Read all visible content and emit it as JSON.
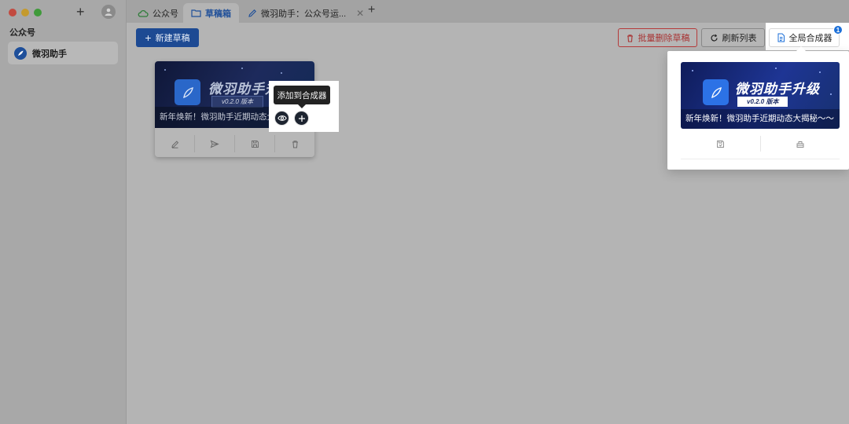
{
  "sidebar": {
    "section_title": "公众号",
    "account_name": "微羽助手"
  },
  "tabs": [
    {
      "label": "公众号",
      "icon": "cloud-icon"
    },
    {
      "label": "草稿箱",
      "icon": "folder-icon"
    },
    {
      "label": "微羽助手：公众号运...",
      "icon": "edit-icon"
    }
  ],
  "toolbar": {
    "new_draft": "新建草稿",
    "batch_delete": "批量删除草稿",
    "refresh": "刷新列表",
    "composer": "全局合成器",
    "composer_badge": "1"
  },
  "draft": {
    "headline": "微羽助手升级",
    "version": "v0.2.0 版本",
    "caption": "新年焕新！微羽助手近期动态大揭秘～～",
    "tooltip": "添加到合成器"
  },
  "composer_panel": {
    "headline": "微羽助手升级",
    "version": "v0.2.0 版本",
    "caption": "新年焕新！微羽助手近期动态大揭秘～～"
  },
  "colors": {
    "primary": "#1d4a93",
    "danger": "#b53a3a",
    "badge": "#1b6fd8"
  }
}
